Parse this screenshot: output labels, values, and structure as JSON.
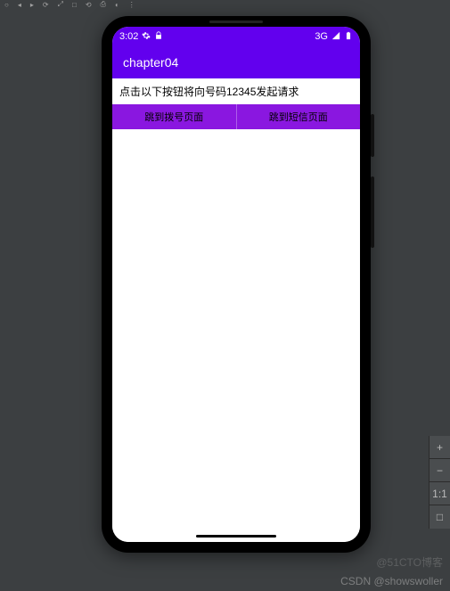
{
  "ide": {
    "toolbar_icons": [
      "○",
      "◂",
      "▸",
      "⟳",
      "⤢",
      "□",
      "⟲",
      "⎙",
      "◐",
      "⋮"
    ]
  },
  "status_bar": {
    "time": "3:02",
    "gear_icon": "gear",
    "lock_icon": "lock",
    "network_label": "3G",
    "signal_icon": "signal",
    "battery_icon": "battery"
  },
  "app_bar": {
    "title": "chapter04"
  },
  "content": {
    "instruction": "点击以下按钮将向号码12345发起请求",
    "buttons": [
      {
        "label": "跳到拨号页面"
      },
      {
        "label": "跳到短信页面"
      }
    ]
  },
  "emulator_controls": {
    "zoom_in": "+",
    "zoom_out": "−",
    "one_to_one": "1:1",
    "fit": "□"
  },
  "watermark": "CSDN @showswoller",
  "watermark2": "@51CTO博客"
}
